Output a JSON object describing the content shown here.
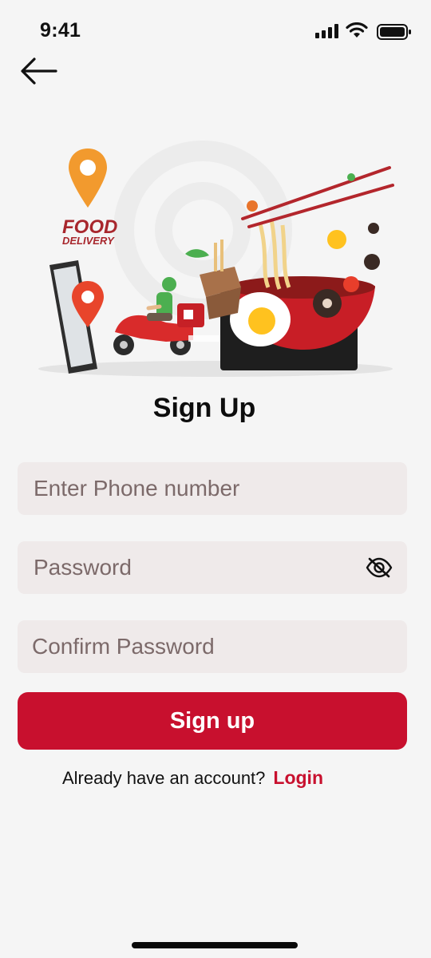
{
  "status_bar": {
    "time": "9:41",
    "icons": [
      "cellular-signal-icon",
      "wifi-icon",
      "battery-icon"
    ]
  },
  "nav": {
    "back_icon": "arrow-left-icon"
  },
  "hero": {
    "logo_line1": "FOOD",
    "logo_line2": "DELIVERY"
  },
  "title": "Sign Up",
  "form": {
    "phone_placeholder": "Enter Phone number",
    "password_placeholder": "Password",
    "confirm_placeholder": "Confirm Password",
    "password_toggle_icon": "eye-slash-icon"
  },
  "signup_button": "Sign up",
  "login_prompt": {
    "text": "Already have an account?",
    "link": "Login"
  },
  "colors": {
    "accent": "#c8102e",
    "background": "#f5f5f5",
    "field_background": "#efeaea",
    "placeholder": "#7c6a6a"
  }
}
